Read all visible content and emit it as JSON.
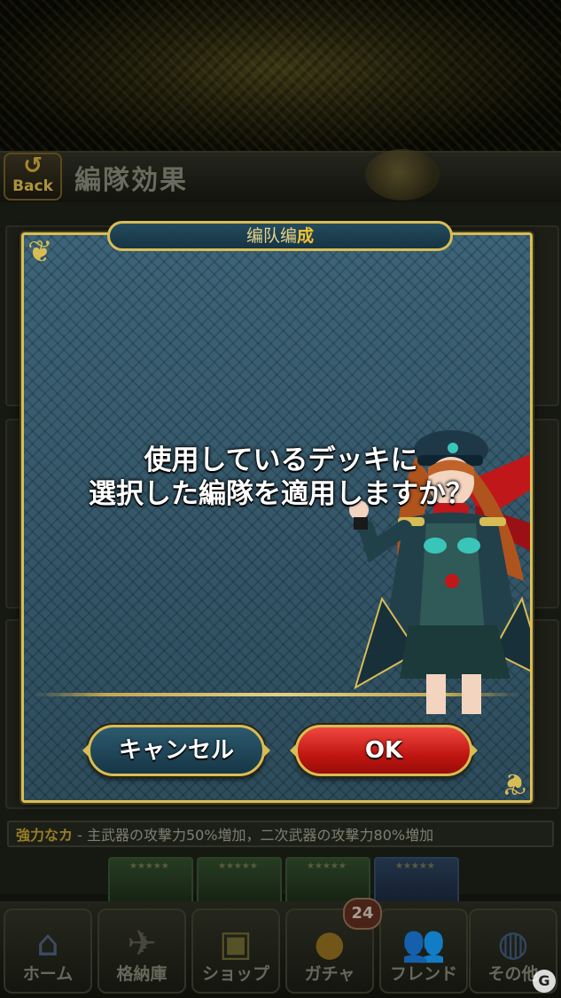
{
  "header": {
    "back_label": "Back",
    "screen_title": "編隊効果"
  },
  "background": {
    "bonus_name": "強力なカ",
    "bonus_desc": " - 主武器の攻撃力50%増加，二次武器の攻撃力80%増加"
  },
  "dialog": {
    "title_prefix": "编队编",
    "title_suffix": "成",
    "message_line1": "使用しているデッキに",
    "message_line2": "選択した編隊を適用しますか？",
    "cancel_label": "キャンセル",
    "ok_label": "OK"
  },
  "nav": {
    "items": [
      {
        "label": "ホーム",
        "icon": "home-icon"
      },
      {
        "label": "格納庫",
        "icon": "hangar-plane-icon"
      },
      {
        "label": "ショップ",
        "icon": "shop-icon"
      },
      {
        "label": "ガチャ",
        "icon": "gacha-ball-icon"
      },
      {
        "label": "フレンド",
        "icon": "friends-icon"
      },
      {
        "label": "その他",
        "icon": "globe-icon"
      }
    ],
    "gacha_badge": "24"
  },
  "colors": {
    "dialog_bg": "#335567",
    "gold_border": "#d8bd55",
    "ok_red": "#c11611",
    "cancel_teal": "#163646"
  }
}
